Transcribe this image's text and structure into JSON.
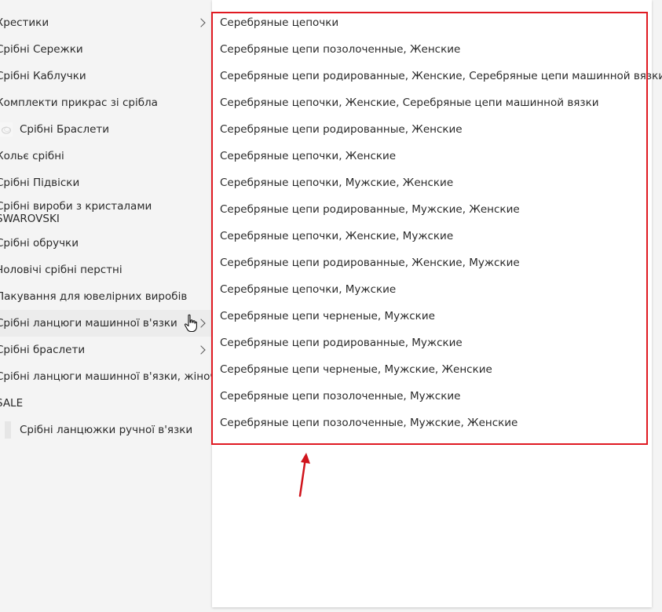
{
  "sidebar": {
    "items": [
      {
        "label": "Хрестики",
        "chevron": true
      },
      {
        "label": "Срібні Сережки"
      },
      {
        "label": "Срібні Каблучки"
      },
      {
        "label": "Комплекти прикрас зі срібла"
      },
      {
        "label": "Срібні Браслети",
        "icon": "bracelet-thumbnail-icon"
      },
      {
        "label": "Кольє срібні"
      },
      {
        "label": "Срібні Підвіски"
      },
      {
        "label": "Срібні вироби з кристалами SWAROVSKI"
      },
      {
        "label": "Срібні обручки"
      },
      {
        "label": "Чоловічі срібні перстні"
      },
      {
        "label": "Пакування для ювелірних виробів"
      },
      {
        "label": "Срібні ланцюги машинної в'язки",
        "chevron": true,
        "hovered": true
      },
      {
        "label": "Срібні браслети",
        "chevron": true
      },
      {
        "label": "Срібні ланцюги машинної в'язки, жіночі"
      },
      {
        "label": "SALE"
      },
      {
        "label": "Срібні ланцюжки ручної в'язки",
        "icon": "placeholder-thumbnail-icon"
      }
    ]
  },
  "submenu": {
    "items": [
      "Серебряные цепочки",
      "Серебряные цепи позолоченные, Женские",
      "Серебряные цепи родированные, Женские, Серебряные цепи машинной вязки",
      "Серебряные цепочки, Женские, Серебряные цепи машинной вязки",
      "Серебряные цепи родированные, Женские",
      "Серебряные цепочки, Женские",
      "Серебряные цепочки, Мужские, Женские",
      "Серебряные цепи родированные, Мужские, Женские",
      "Серебряные цепочки, Женские, Мужские",
      "Серебряные цепи родированные, Женские, Мужские",
      "Серебряные цепочки, Мужские",
      "Серебряные цепи черненые, Мужские",
      "Серебряные цепи родированные, Мужские",
      "Серебряные цепи черненые, Мужские, Женские",
      "Серебряные цепи позолоченные, Мужские",
      "Серебряные цепи позолоченные, Мужские, Женские"
    ]
  },
  "annotation": {
    "box_color": "#e01a22",
    "arrow_color": "#d0141c"
  },
  "icons": {
    "chevron": "chevron-right-icon",
    "cursor": "hand-pointer-icon",
    "arrow": "arrow-up-icon"
  }
}
